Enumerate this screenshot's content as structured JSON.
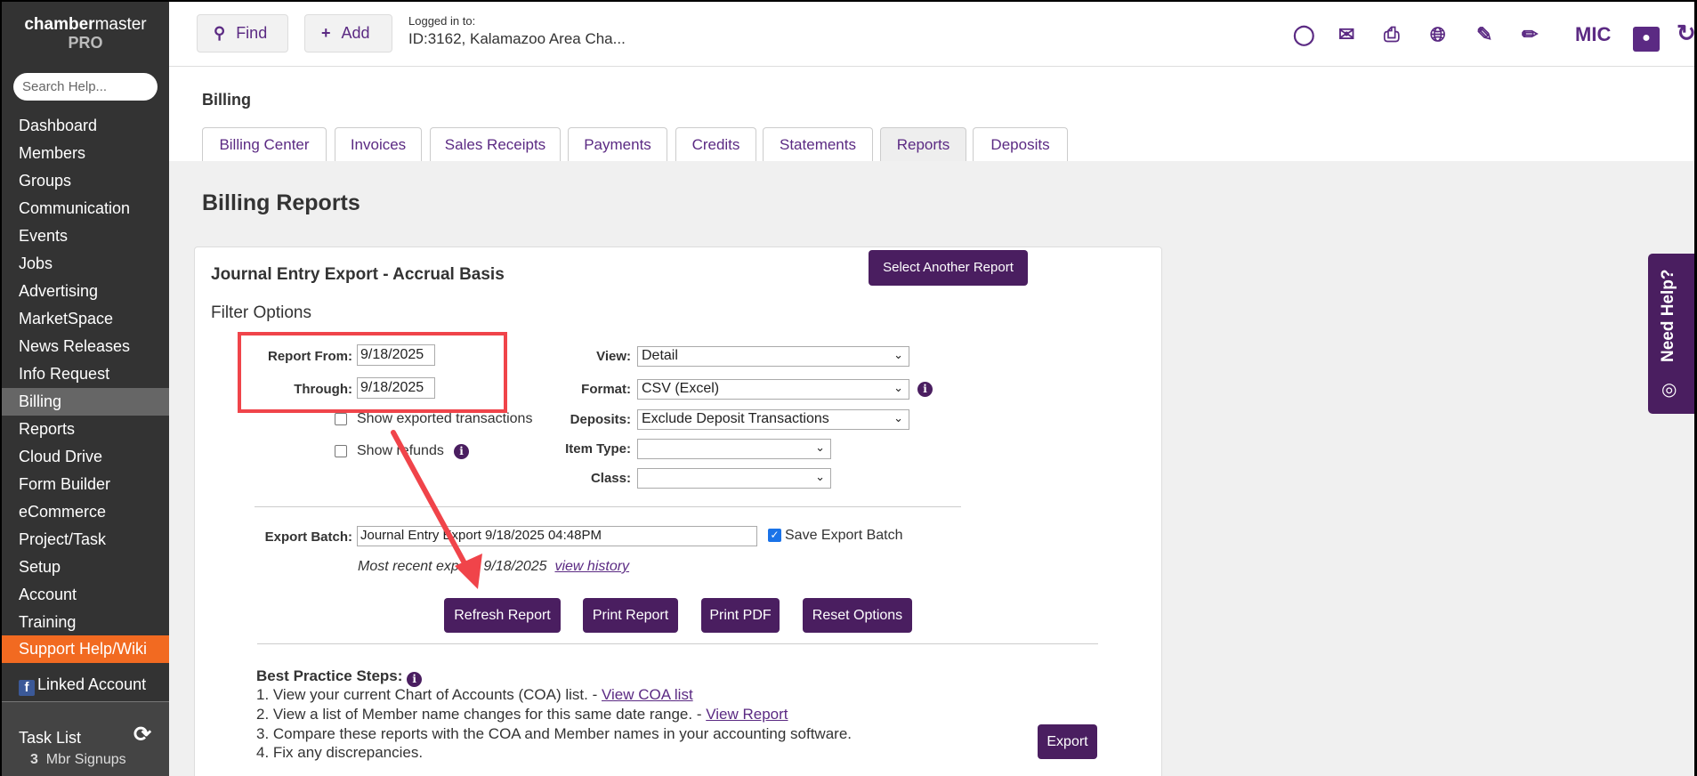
{
  "sidebar": {
    "logo_bold": "chamber",
    "logo_light": "master",
    "logo_pro": "PRO",
    "search_placeholder": "Search Help...",
    "items": [
      "Dashboard",
      "Members",
      "Groups",
      "Communication",
      "Events",
      "Jobs",
      "Advertising",
      "MarketSpace",
      "News Releases",
      "Info Request",
      "Billing",
      "Reports",
      "Cloud Drive",
      "Form Builder",
      "eCommerce",
      "Project/Task",
      "Setup",
      "Account",
      "Training"
    ],
    "support": "Support Help/Wiki",
    "linked": "Linked Account",
    "tasklist": "Task List",
    "task_count": "3",
    "task_label": "Mbr Signups"
  },
  "topbar": {
    "find": "Find",
    "add": "Add",
    "logged_label": "Logged in to:",
    "logged_value": "ID:3162, Kalamazoo Area Cha...",
    "user": "MIC"
  },
  "page": {
    "section": "Billing",
    "tabs": [
      "Billing Center",
      "Invoices",
      "Sales Receipts",
      "Payments",
      "Credits",
      "Statements",
      "Reports",
      "Deposits"
    ],
    "active_tab": "Reports",
    "title": "Billing Reports"
  },
  "report": {
    "title": "Journal Entry Export - Accrual Basis",
    "select_another": "Select Another Report",
    "filter_options": "Filter Options",
    "report_from_label": "Report From:",
    "report_from": "9/18/2025",
    "through_label": "Through:",
    "through": "9/18/2025",
    "show_exported": "Show exported transactions",
    "show_refunds": "Show refunds",
    "view_label": "View:",
    "view": "Detail",
    "format_label": "Format:",
    "format": "CSV (Excel)",
    "deposits_label": "Deposits:",
    "deposits": "Exclude Deposit Transactions",
    "item_type_label": "Item Type:",
    "item_type": "",
    "class_label": "Class:",
    "class": "",
    "export_batch_label": "Export Batch:",
    "export_batch": "Journal Entry Export 9/18/2025 04:48PM",
    "save_export_batch": "Save Export Batch",
    "most_recent": "Most recent export: 9/18/2025",
    "view_history": "view history",
    "buttons": {
      "refresh": "Refresh Report",
      "print": "Print Report",
      "pdf": "Print PDF",
      "reset": "Reset Options",
      "export": "Export"
    },
    "best_practice_title": "Best Practice Steps:",
    "step1": "1. View your current Chart of Accounts (COA) list. - ",
    "step1_link": "View COA list",
    "step2": "2. View a list of Member name changes for this same date range. - ",
    "step2_link": "View Report",
    "step3": "3. Compare these reports with the COA and Member names in your accounting software.",
    "step4": "4. Fix any discrepancies."
  },
  "need_help": "Need Help?",
  "colors": {
    "purple": "#4a1e60",
    "accent_text": "#5b2a83",
    "orange": "#f26a21",
    "annotation": "#f0444a"
  }
}
